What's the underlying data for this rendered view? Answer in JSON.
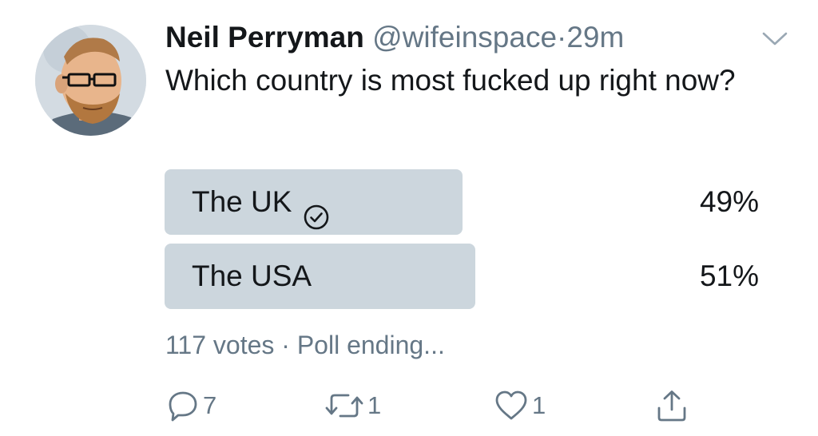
{
  "tweet": {
    "author_name": "Neil Perryman",
    "handle": "@wifeinspace",
    "separator": "·",
    "time": "29m",
    "text": "Which country is most fucked up right now?"
  },
  "poll": {
    "options": [
      {
        "label": "The UK",
        "percent_text": "49%",
        "percent": 49,
        "selected": true
      },
      {
        "label": "The USA",
        "percent_text": "51%",
        "percent": 51,
        "selected": false
      }
    ],
    "votes": "117 votes",
    "separator": "·",
    "status": "Poll ending..."
  },
  "actions": {
    "reply": {
      "icon": "reply-icon",
      "count": "7"
    },
    "retweet": {
      "icon": "retweet-icon",
      "count": "1"
    },
    "like": {
      "icon": "heart-icon",
      "count": "1"
    },
    "share": {
      "icon": "share-icon"
    }
  },
  "colors": {
    "text": "#14171a",
    "secondary": "#657786",
    "poll_bar": "#ccd6dd"
  }
}
